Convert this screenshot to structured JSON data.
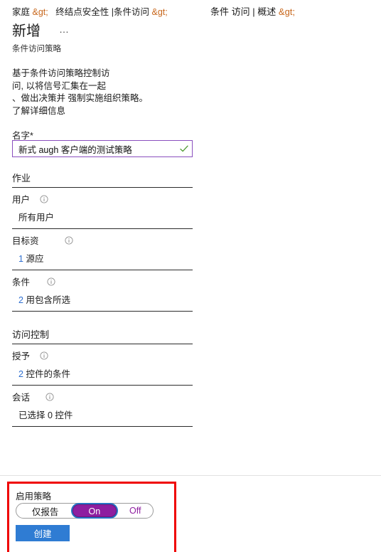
{
  "breadcrumb": {
    "left": {
      "home": "家庭",
      "gt1": "&gt;",
      "endpoint_security": "终结点安全性",
      "separator": "|",
      "conditional_access": "条件访问",
      "gt2": "&gt;"
    },
    "right": {
      "conditional_access": "条件 访问",
      "separator": "|",
      "overview": "概述",
      "gt": "&gt;"
    }
  },
  "header": {
    "title": "新增",
    "overflow_menu": "…",
    "subtitle": "条件访问策略"
  },
  "description": {
    "line1": "基于条件访问策略控制访",
    "line2": "问, 以将信号汇集在一起",
    "line3": "、做出决策并 强制实施组织策略。",
    "learn_more": "了解详细信息"
  },
  "name_field": {
    "label": "名字",
    "required_mark": "*",
    "value": "新式 augh 客户端的测试策略",
    "valid_icon": "checkmark-icon"
  },
  "sections": [
    {
      "heading": "作业",
      "rows": [
        {
          "label": "用户",
          "info_icon": "info-icon",
          "value_prefix": "",
          "value": "所有用户"
        },
        {
          "label": "目标资",
          "info_icon": "info-icon",
          "value_prefix": "1",
          "value": "源应"
        },
        {
          "label": "条件",
          "info_icon": "info-icon",
          "value_prefix": "2",
          "value": "用包含所选"
        }
      ]
    },
    {
      "heading": "访问控制",
      "rows": [
        {
          "label": "授予",
          "info_icon": "info-icon",
          "value_prefix": "2",
          "value": "控件的条件"
        },
        {
          "label": "会话",
          "info_icon": "info-icon",
          "value_prefix": "",
          "value": "已选择 0 控件"
        }
      ]
    }
  ],
  "footer": {
    "enable_label": "启用策略",
    "toggle": {
      "report_only": "仅报告",
      "on": "On",
      "off": "Off",
      "selected": "On",
      "selected_color": "#8e1ea0",
      "focus_ring_color": "#2673c4"
    },
    "create_button": "创建"
  },
  "annotation": {
    "highlight_color": "#ef0000"
  },
  "colors": {
    "gt_entity": "#c8671c",
    "link_blue": "#2f6fd0",
    "input_border": "#8a4fbe",
    "valid_check": "#4f9b33",
    "primary_button": "#2f7cd3"
  }
}
